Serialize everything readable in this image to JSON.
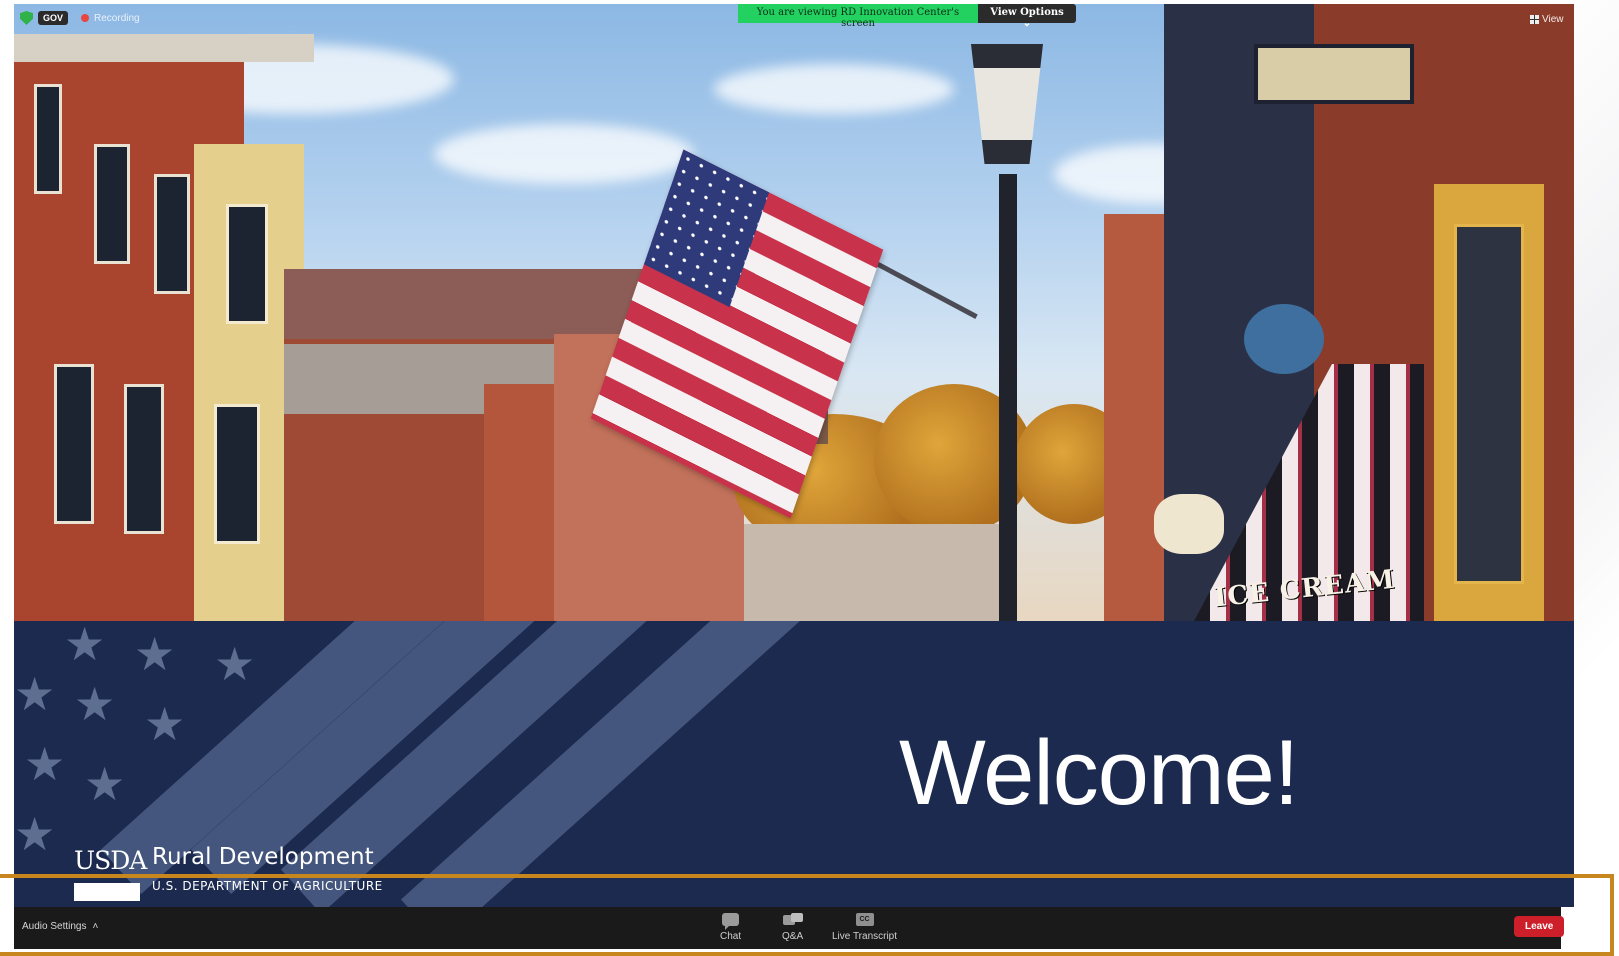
{
  "top_left": {
    "badge": "GOV",
    "recording": "Recording"
  },
  "share_banner": {
    "message": "You are viewing RD Innovation Center's screen",
    "view_options": "View Options ⌄"
  },
  "view_top_right": "View",
  "slide": {
    "storefront_sign": "ICE CREAM",
    "welcome": "Welcome!",
    "agency_logo": "USDA",
    "agency_name": "Rural Development",
    "agency_sub": "U.S. DEPARTMENT OF AGRICULTURE"
  },
  "controls": {
    "audio_settings": "Audio Settings",
    "audio_chevron": "˄",
    "chat": "Chat",
    "qa": "Q&A",
    "cc_glyph": "CC",
    "live_transcript": "Live Transcript",
    "leave": "Leave"
  },
  "colors": {
    "share_green": "#23d160",
    "leave_red": "#cc1f2a",
    "highlight": "#c8861f",
    "slide_navy": "#1b2a4e"
  }
}
